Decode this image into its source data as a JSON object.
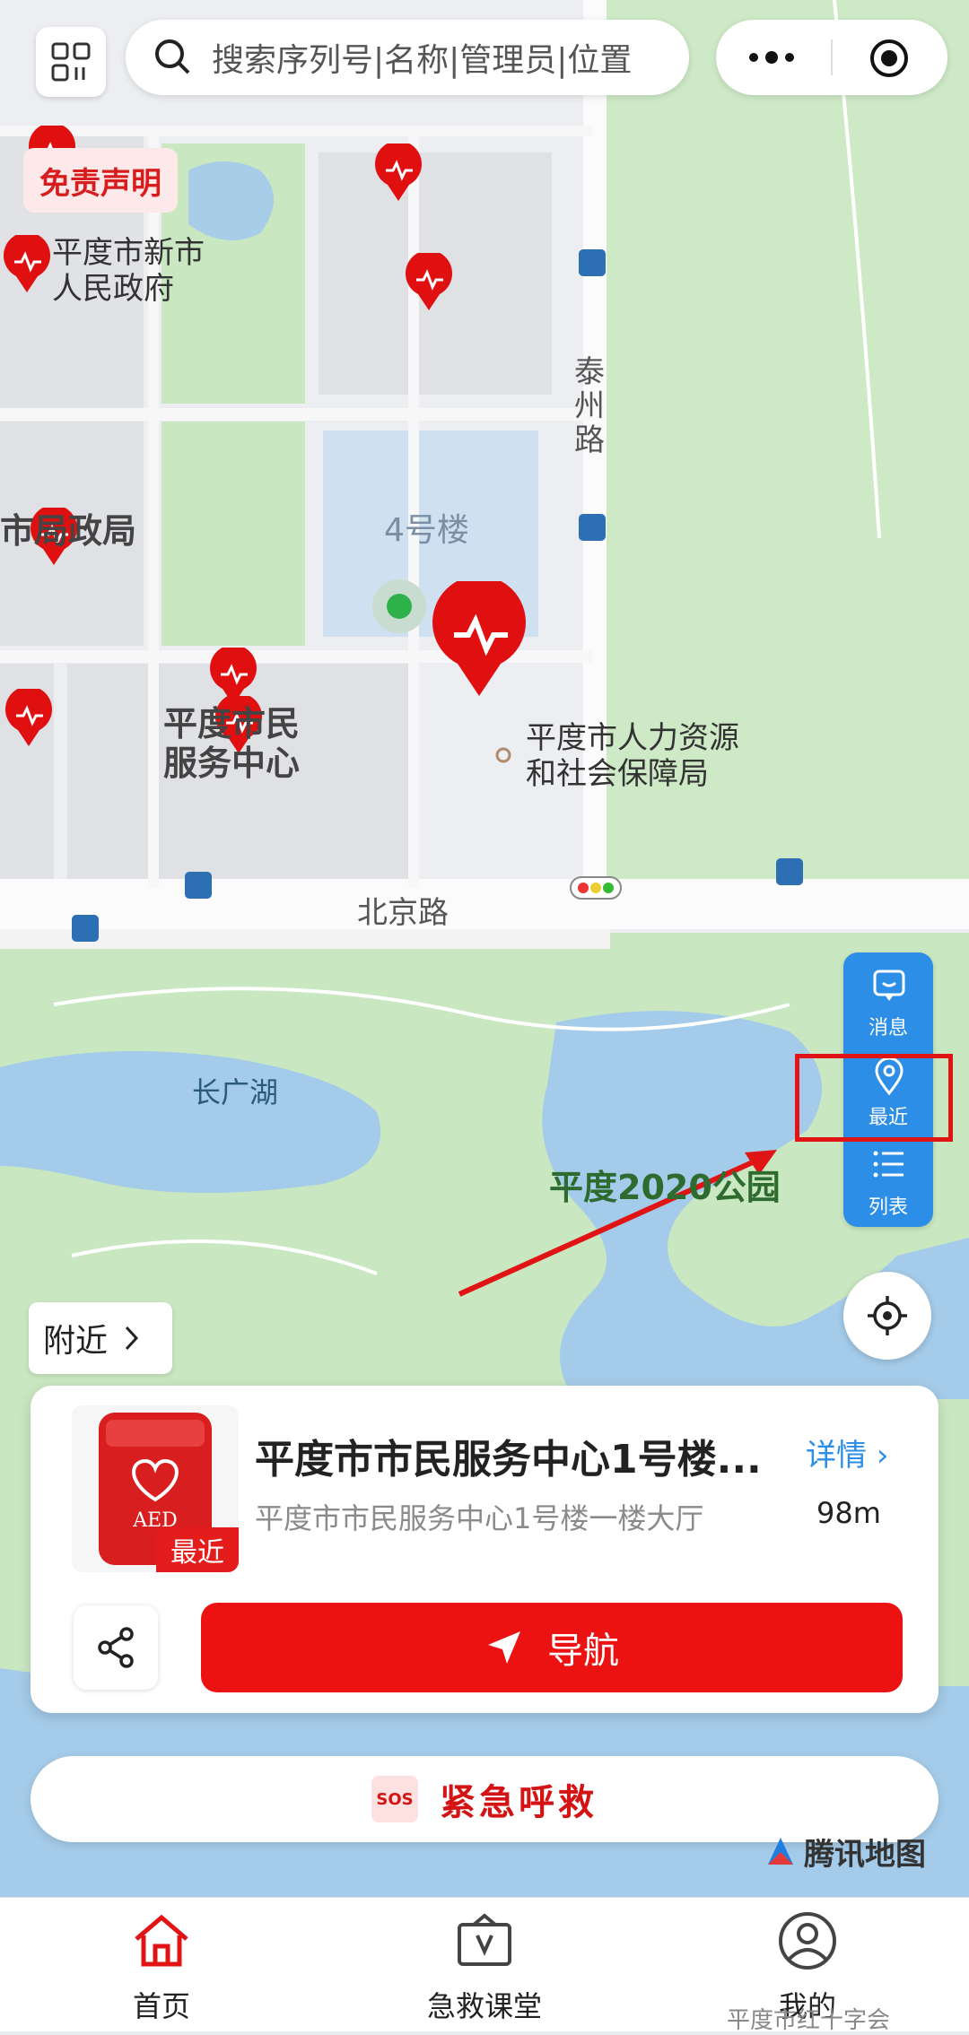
{
  "topbar": {
    "search_placeholder": "搜索序列号|名称|管理员|位置"
  },
  "disclaimer": "免责声明",
  "map": {
    "labels": [
      {
        "id": "gov",
        "text": "平度市新市\n人民政府"
      },
      {
        "id": "bureau",
        "text": "市局政局"
      },
      {
        "id": "bldg4",
        "text": "4号楼"
      },
      {
        "id": "service",
        "text": "平度市民\n服务中心"
      },
      {
        "id": "hr",
        "text": "平度市人力资源\n和社会保障局"
      },
      {
        "id": "taizhou",
        "text": "泰\n州\n路"
      },
      {
        "id": "beijing",
        "text": "北京路"
      },
      {
        "id": "lake",
        "text": "长广湖"
      },
      {
        "id": "park",
        "text": "平度2020公园"
      }
    ]
  },
  "side_panel": {
    "items": [
      {
        "label": "消息",
        "icon": "message-icon"
      },
      {
        "label": "最近",
        "icon": "location-pin-icon"
      },
      {
        "label": "列表",
        "icon": "list-icon"
      }
    ]
  },
  "nearby_label": "附近",
  "card": {
    "name": "平度市市民服务中心1号楼...",
    "address": "平度市市民服务中心1号楼一楼大厅",
    "detail_label": "详情",
    "distance": "98m",
    "tag": "最近",
    "nav_label": "导航",
    "device_text": "AED"
  },
  "sos": {
    "badge": "SOS",
    "label": "紧急呼救"
  },
  "tencent_map": "腾讯地图",
  "tabs": [
    {
      "label": "首页",
      "icon": "home-icon",
      "active": true
    },
    {
      "label": "急救课堂",
      "icon": "classroom-icon",
      "active": false
    },
    {
      "label": "我的",
      "icon": "profile-icon",
      "active": false
    }
  ],
  "watermark": "平度市红十字会",
  "colors": {
    "accent": "#ed1212",
    "blue": "#2c8ee6",
    "park": "#c8e6c0",
    "water": "#a4cbe9"
  }
}
